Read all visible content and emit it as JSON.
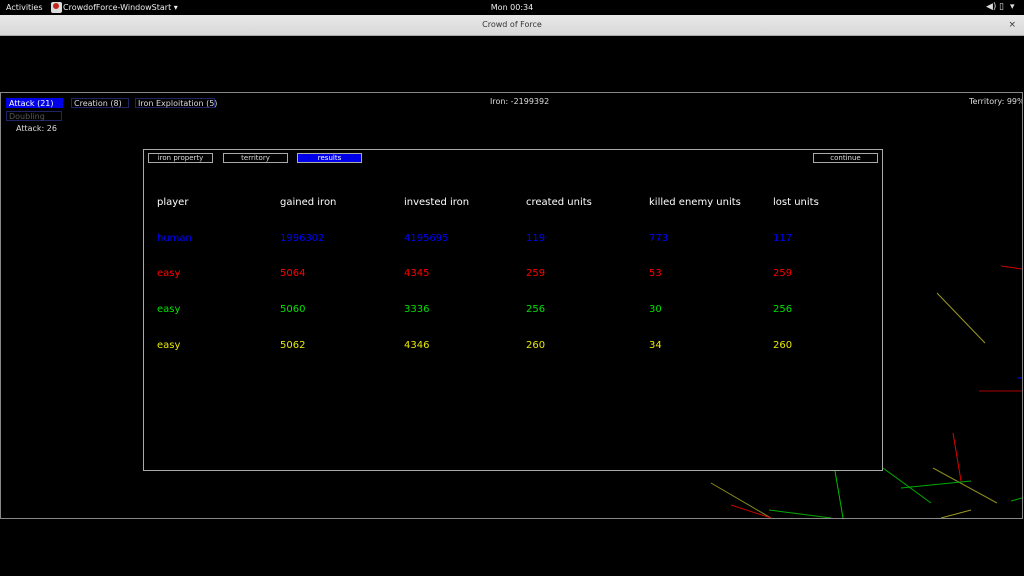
{
  "topbar": {
    "activities": "Activities",
    "app_name": "CrowdofForce-WindowStart ▾",
    "clock": "Mon 00:34",
    "icons": [
      "audio-icon",
      "battery-icon",
      "power-menu-icon"
    ]
  },
  "window": {
    "title": "Crowd of Force",
    "close_glyph": "×"
  },
  "hud": {
    "buttons": {
      "attack": "Attack (21)",
      "creation": "Creation (8)",
      "iron_exploitation": "Iron Exploitation (5)",
      "doubling": "Doubling"
    },
    "attack_count": "Attack: 26",
    "iron": "Iron: -2199392",
    "territory": "Territory: 99%"
  },
  "dialog": {
    "tabs": [
      "iron property",
      "territory",
      "results"
    ],
    "active_tab": "results",
    "continue_label": "continue",
    "columns": [
      "player",
      "gained iron",
      "invested iron",
      "created units",
      "killed enemy units",
      "lost units"
    ],
    "rows": [
      {
        "color": "#0000ff",
        "cells": [
          "human",
          "1996302",
          "4195695",
          "119",
          "773",
          "117"
        ]
      },
      {
        "color": "#ff0000",
        "cells": [
          "easy",
          "5064",
          "4345",
          "259",
          "53",
          "259"
        ]
      },
      {
        "color": "#00e000",
        "cells": [
          "easy",
          "5060",
          "3336",
          "256",
          "30",
          "256"
        ]
      },
      {
        "color": "#e8e800",
        "cells": [
          "easy",
          "5062",
          "4346",
          "260",
          "34",
          "260"
        ]
      }
    ]
  },
  "colors": {
    "accent_blue": "#0000e8",
    "background": "#000000"
  }
}
